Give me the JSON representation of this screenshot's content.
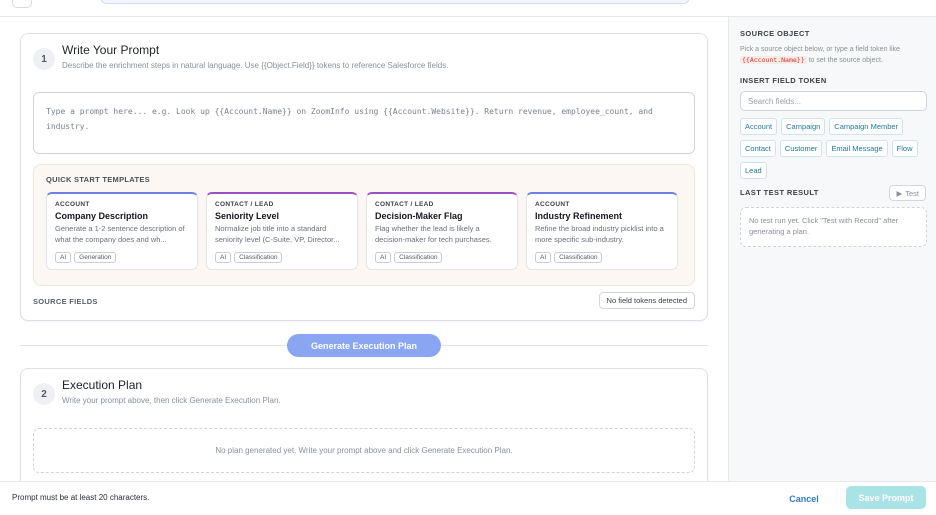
{
  "step1": {
    "number": "1",
    "title": "Write Your Prompt",
    "subtitle": "Describe the enrichment steps in natural language. Use {{Object.Field}} tokens to reference Salesforce fields.",
    "prompt_placeholder": "Type a prompt here... e.g. Look up {{Account.Name}} on ZoomInfo using {{Account.Website}}. Return revenue, employee_count, and industry."
  },
  "templates": {
    "title": "QUICK START TEMPLATES",
    "items": [
      {
        "category": "ACCOUNT",
        "name": "Company Description",
        "description": "Generate a 1-2 sentence description of what the company does and wh...",
        "tags": [
          "AI",
          "Generation"
        ],
        "accent": "#6c7ee1"
      },
      {
        "category": "CONTACT / LEAD",
        "name": "Seniority Level",
        "description": "Normalize job title into a standard seniority level (C-Suite, VP, Director...",
        "tags": [
          "AI",
          "Classification"
        ],
        "accent": "#9b4fc4"
      },
      {
        "category": "CONTACT / LEAD",
        "name": "Decision-Maker Flag",
        "description": "Flag whether the lead is likely a decision-maker for tech purchases.",
        "tags": [
          "AI",
          "Classification"
        ],
        "accent": "#9b4fc4"
      },
      {
        "category": "ACCOUNT",
        "name": "Industry Refinement",
        "description": "Refine the broad industry picklist into a more specific sub-industry.",
        "tags": [
          "AI",
          "Classification"
        ],
        "accent": "#6c7ee1"
      }
    ]
  },
  "source_fields": {
    "label": "SOURCE FIELDS",
    "status": "No field tokens detected"
  },
  "generate_button": "Generate Execution Plan",
  "step2": {
    "number": "2",
    "title": "Execution Plan",
    "subtitle": "Write your prompt above, then click Generate Execution Plan.",
    "empty": "No plan generated yet. Write your prompt above and click Generate Execution Plan."
  },
  "sidebar": {
    "source_object_title": "SOURCE OBJECT",
    "source_object_help_before": "Pick a source object below, or type a field token like ",
    "source_object_help_code": "{{Account.Name}}",
    "source_object_help_after": " to set the source object.",
    "insert_token_title": "INSERT FIELD TOKEN",
    "search_placeholder": "Search fields...",
    "objects": [
      "Account",
      "Campaign",
      "Campaign Member",
      "Contact",
      "Customer",
      "Email Message",
      "Flow",
      "Lead"
    ],
    "last_test_title": "LAST TEST RESULT",
    "test_button": "Test",
    "test_empty": "No test run yet. Click \"Test with Record\" after generating a plan."
  },
  "footer": {
    "status": "Prompt must be at least 20 characters.",
    "cancel": "Cancel",
    "save": "Save Prompt"
  }
}
